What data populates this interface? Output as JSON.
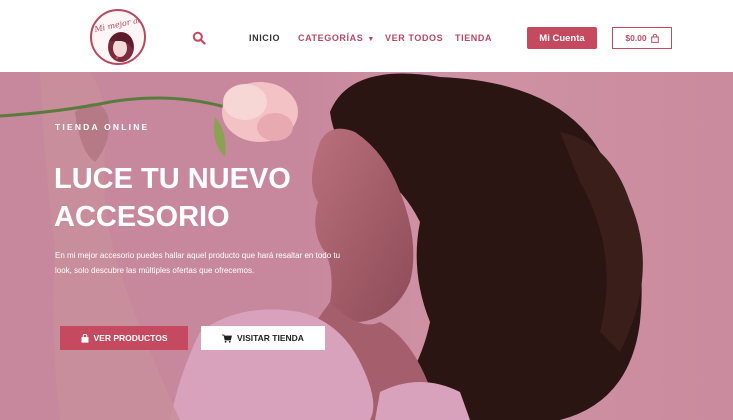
{
  "header": {
    "logo_text": "Mi mejor accesorio",
    "nav": {
      "inicio": "INICIO",
      "categorias": "CATEGORÍAS",
      "ver_todos": "VER TODOS",
      "tienda": "TIENDA"
    },
    "account_button": "Mi Cuenta",
    "cart_total": "$0.00"
  },
  "hero": {
    "kicker": "TIENDA ONLINE",
    "headline_line1": "LUCE TU NUEVO",
    "headline_line2": "ACCESORIO",
    "description": "En mi mejor accesorio puedes hallar aquel producto que hará resaltar en todo tu look, solo descubre las múltiples ofertas que ofrecemos.",
    "button_products": "VER PRODUCTOS",
    "button_store": "VISITAR TIENDA"
  },
  "colors": {
    "brand": "#c64a5f",
    "hero_bg": "#c98aa1"
  },
  "icons": {
    "search": "search-icon",
    "caret": "chevron-down-icon",
    "bag": "shopping-bag-icon",
    "cart": "shopping-cart-icon"
  }
}
